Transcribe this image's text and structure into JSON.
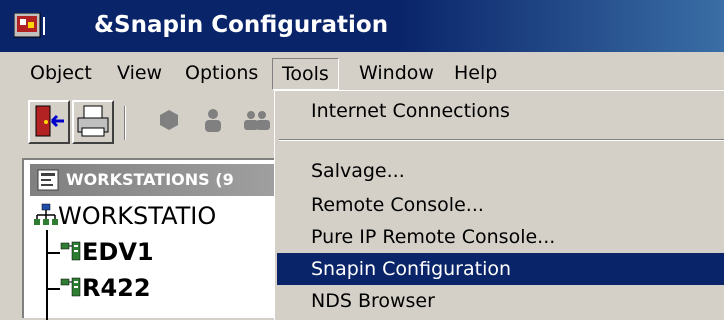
{
  "window": {
    "title": "&Snapin Configuration"
  },
  "menubar": {
    "items": [
      {
        "label": "Object"
      },
      {
        "label": "View"
      },
      {
        "label": "Options"
      },
      {
        "label": "Tools"
      },
      {
        "label": "Window"
      },
      {
        "label": "Help"
      }
    ]
  },
  "toolbar": {
    "buttons": [
      {
        "icon": "exit-door-icon"
      },
      {
        "icon": "printer-icon"
      },
      {
        "icon": "object-icon"
      },
      {
        "icon": "user-icon"
      },
      {
        "icon": "group-icon"
      }
    ]
  },
  "tree": {
    "header": "WORKSTATIONS (9",
    "root": "WORKSTATIO",
    "items": [
      {
        "label": "EDV1"
      },
      {
        "label": "R422"
      }
    ]
  },
  "tools_menu": {
    "items": [
      {
        "label": "Internet Connections"
      },
      {
        "label": "Salvage..."
      },
      {
        "label": "Remote Console..."
      },
      {
        "label": "Pure IP Remote Console..."
      },
      {
        "label": "Snapin Configuration",
        "highlighted": true
      },
      {
        "label": "NDS Browser"
      }
    ]
  },
  "colors": {
    "titlebar": "#0a246a",
    "highlight": "#0a246a",
    "face": "#d4d0c8"
  }
}
